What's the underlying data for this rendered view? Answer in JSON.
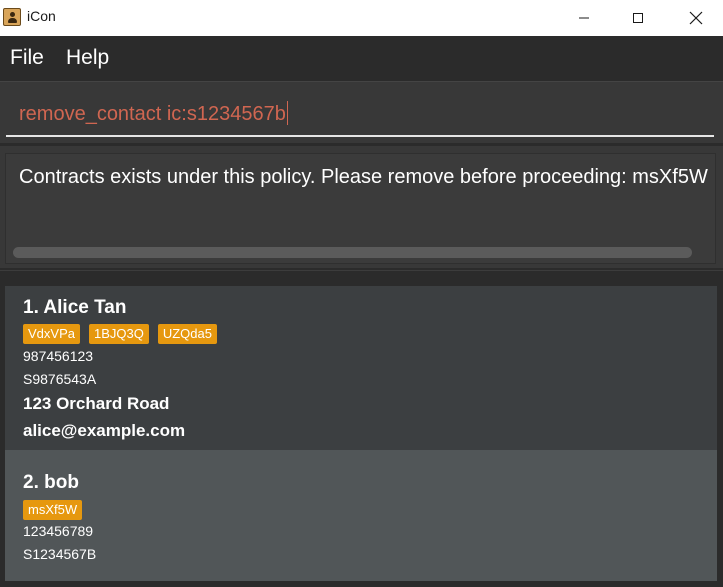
{
  "window": {
    "title": "iCon"
  },
  "menu": {
    "items": [
      {
        "label": "File"
      },
      {
        "label": "Help"
      }
    ]
  },
  "command": {
    "value": "remove_contact ic:s1234567b",
    "text_color": "#d06651"
  },
  "result": {
    "message": "Contracts exists under this policy. Please remove before proceeding: msXf5W"
  },
  "persons": [
    {
      "index_name": "1. Alice Tan",
      "tags": [
        "VdxVPa",
        "1BJQ3Q",
        "UZQda5"
      ],
      "phone": "987456123",
      "ic": "S9876543A",
      "address": "123 Orchard Road",
      "email": "alice@example.com"
    },
    {
      "index_name": "2. bob",
      "tags": [
        "msXf5W"
      ],
      "phone": "123456789",
      "ic": "S1234567B"
    }
  ],
  "colors": {
    "tag": "#e6980f",
    "card_default": "#3c3f41",
    "card_selected": "#515658",
    "background": "#2b2b2b"
  },
  "icons": {
    "app": "contact-book-icon",
    "minimize": "minimize-icon",
    "maximize": "maximize-icon",
    "close": "close-icon"
  }
}
